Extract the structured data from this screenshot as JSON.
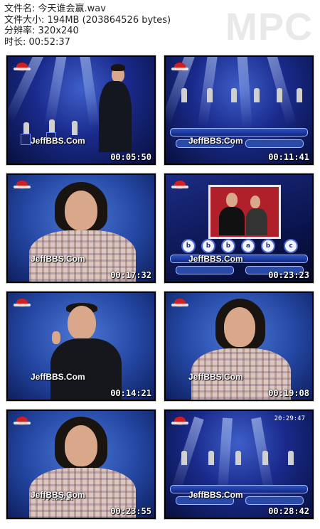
{
  "file_info": {
    "name": "文件名: 今天谁会赢.wav",
    "size": "文件大小: 194MB (203864526 bytes)",
    "resolution": "分辨率: 320x240",
    "duration": "时长: 00:52:37"
  },
  "logo": "MPC",
  "thumbnails": [
    {
      "time": "00:05:50",
      "watermark": "JeffBBS.Com"
    },
    {
      "time": "00:11:41",
      "watermark": "JeffBBS.Com"
    },
    {
      "time": "00:17:32",
      "watermark": "JeffBBS.Com"
    },
    {
      "time": "00:23:23",
      "watermark": "JeffBBS.Com"
    },
    {
      "time": "00:14:21",
      "watermark": "JeffBBS.Com"
    },
    {
      "time": "00:19:08",
      "watermark": "JeffBBS.Com"
    },
    {
      "time": "00:23:55",
      "watermark": "JeffBBS.Com",
      "caption": "今天谁会赢"
    },
    {
      "time": "00:28:42",
      "watermark": "JeffBBS.Com",
      "clock": "20:29:47"
    }
  ]
}
